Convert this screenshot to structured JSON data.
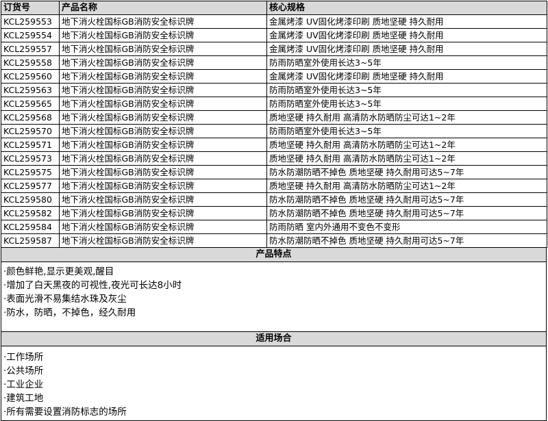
{
  "table": {
    "headers": [
      "订货号",
      "产品名称",
      "核心规格"
    ],
    "rows": [
      [
        "KCL259553",
        "地下消火栓国标GB消防安全标识牌",
        "金属烤漆 UV固化烤漆印刷 质地坚硬 持久耐用"
      ],
      [
        "KCL259554",
        "地下消火栓国标GB消防安全标识牌",
        "金属烤漆 UV固化烤漆印刷 质地坚硬 持久耐用"
      ],
      [
        "KCL259557",
        "地下消火栓国标GB消防安全标识牌",
        "金属烤漆 UV固化烤漆印刷 质地坚硬 持久耐用"
      ],
      [
        "KCL259558",
        "地下消火栓国标GB消防安全标识牌",
        "防雨防晒室外使用长达3~5年"
      ],
      [
        "KCL259560",
        "地下消火栓国标GB消防安全标识牌",
        "金属烤漆 UV固化烤漆印刷 质地坚硬 持久耐用"
      ],
      [
        "KCL259563",
        "地下消火栓国标GB消防安全标识牌",
        "防雨防晒室外使用长达3~5年"
      ],
      [
        "KCL259565",
        "地下消火栓国标GB消防安全标识牌",
        "防雨防晒室外使用长达3~5年"
      ],
      [
        "KCL259568",
        "地下消火栓国标GB消防安全标识牌",
        "质地坚硬 持久耐用 高清防水防晒防尘可达1~2年"
      ],
      [
        "KCL259570",
        "地下消火栓国标GB消防安全标识牌",
        "防雨防晒室外使用长达3~5年"
      ],
      [
        "KCL259571",
        "地下消火栓国标GB消防安全标识牌",
        "质地坚硬 持久耐用 高清防水防晒防尘可达1~2年"
      ],
      [
        "KCL259573",
        "地下消火栓国标GB消防安全标识牌",
        "质地坚硬 持久耐用 高清防水防晒防尘可达1~2年"
      ],
      [
        "KCL259575",
        "地下消火栓国标GB消防安全标识牌",
        "防水防潮防晒不掉色 质地坚硬 持久耐用可达5~7年"
      ],
      [
        "KCL259577",
        "地下消火栓国标GB消防安全标识牌",
        "质地坚硬 持久耐用 高清防水防晒防尘可达1~2年"
      ],
      [
        "KCL259580",
        "地下消火栓国标GB消防安全标识牌",
        "防水防潮防晒不掉色 质地坚硬 持久耐用可达5~7年"
      ],
      [
        "KCL259582",
        "地下消火栓国标GB消防安全标识牌",
        "防水防潮防晒不掉色 质地坚硬 持久耐用可达5~7年"
      ],
      [
        "KCL259584",
        "地下消火栓国标GB消防安全标识牌",
        "防雨防晒 室内外通用不变色不变形"
      ],
      [
        "KCL259587",
        "地下消火栓国标GB消防安全标识牌",
        "防水防潮防晒不掉色 质地坚硬 持久耐用可达5~7年"
      ]
    ]
  },
  "features": {
    "title": "产品特点",
    "items": [
      "·颜色鲜艳,显示更美观,醒目",
      "·增加了白天黑夜的可视性,夜光可长达8小时",
      "·表面光滑不易集结水珠及灰尘",
      "·防水，防晒，不掉色，经久耐用"
    ]
  },
  "uses": {
    "title": "适用场合",
    "items": [
      "·工作场所",
      "·公共场所",
      "·工业企业",
      "·建筑工地",
      "·所有需要设置消防标志的场所"
    ]
  }
}
